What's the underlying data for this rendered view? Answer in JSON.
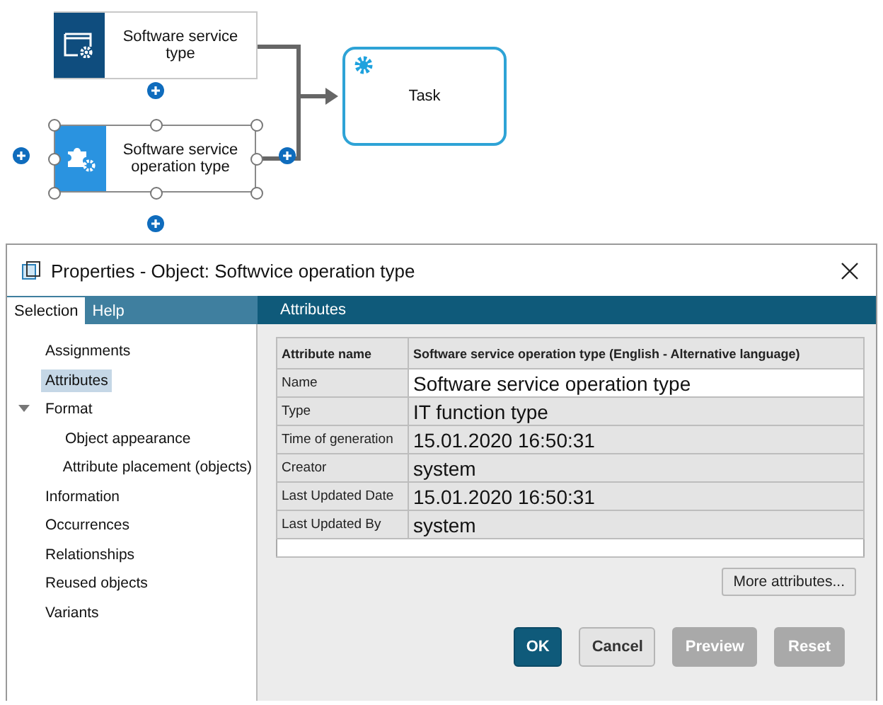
{
  "diagram": {
    "nodes": [
      {
        "kind": "service",
        "label": "Software service type",
        "selected": false
      },
      {
        "kind": "operation",
        "label": "Software service operation type",
        "selected": true
      },
      {
        "kind": "task",
        "label": "Task"
      }
    ]
  },
  "dialog": {
    "title": "Properties - Object: Softwvice operation type",
    "tabs": [
      {
        "label": "Selection",
        "selected": true
      },
      {
        "label": "Help",
        "selected": false
      }
    ],
    "tree": [
      {
        "label": "Assignments",
        "selected": false
      },
      {
        "label": "Attributes",
        "selected": true
      },
      {
        "label": "Format",
        "selected": false,
        "expanded": true,
        "children": [
          {
            "label": "Object appearance",
            "selected": false
          },
          {
            "label": "Attribute placement (objects)",
            "selected": false
          }
        ]
      },
      {
        "label": "Information",
        "selected": false
      },
      {
        "label": "Occurrences",
        "selected": false
      },
      {
        "label": "Relationships",
        "selected": false
      },
      {
        "label": "Reused objects",
        "selected": false
      },
      {
        "label": "Variants",
        "selected": false
      }
    ],
    "panel_title": "Attributes",
    "table": {
      "columns": [
        "Attribute name",
        "Software service operation type (English - Alternative language)"
      ],
      "rows": [
        {
          "name": "Name",
          "value": "Software service operation type",
          "editable": true
        },
        {
          "name": "Type",
          "value": "IT function type",
          "editable": false
        },
        {
          "name": "Time of generation",
          "value": "15.01.2020 16:50:31",
          "editable": false
        },
        {
          "name": "Creator",
          "value": "system",
          "editable": false
        },
        {
          "name": "Last Updated Date",
          "value": "15.01.2020 16:50:31",
          "editable": false
        },
        {
          "name": "Last Updated By",
          "value": "system",
          "editable": false
        }
      ]
    },
    "more_button": "More attributes...",
    "buttons": [
      {
        "label": "OK",
        "primary": true,
        "disabled": false
      },
      {
        "label": "Cancel",
        "primary": false,
        "disabled": false
      },
      {
        "label": "Preview",
        "primary": false,
        "disabled": true
      },
      {
        "label": "Reset",
        "primary": false,
        "disabled": true
      }
    ]
  }
}
